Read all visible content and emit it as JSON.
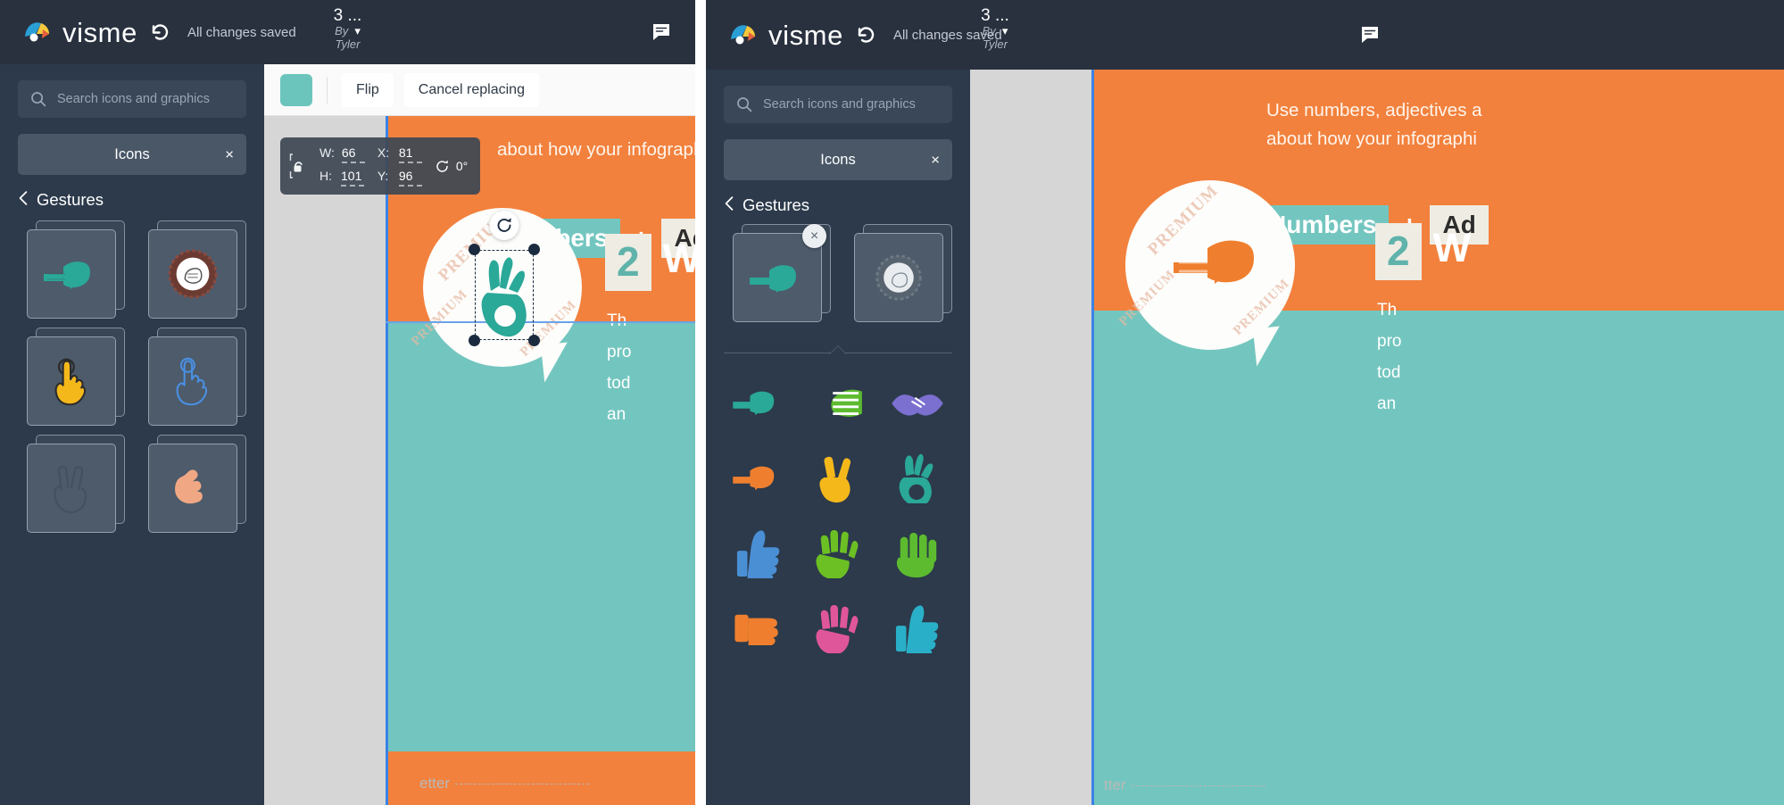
{
  "app": {
    "brand": "visme",
    "save_status": "All changes saved",
    "doc_title": "3 ...",
    "doc_by": "By",
    "doc_author": "Tyler",
    "icons": {
      "undo": "undo-icon",
      "comment": "comment-icon",
      "search": "search-icon",
      "logo": "visme-logo-icon"
    }
  },
  "colors": {
    "topbar": "#29313f",
    "sidebar": "#2c3a4b",
    "accent_teal": "#6cc5bd",
    "accent_orange": "#f2813d",
    "slide_teal": "#73c6bf",
    "guide_blue": "#3b82e6",
    "card": "#4d5b6b"
  },
  "sidebar": {
    "search_placeholder": "Search icons and graphics",
    "category_label": "Icons",
    "close_label": "×",
    "breadcrumb_back": "‹",
    "breadcrumb_label": "Gestures"
  },
  "left_panel": {
    "toolbar": {
      "swatch_color": "#6cc5bd",
      "flip_label": "Flip",
      "cancel_label": "Cancel replacing"
    },
    "transform": {
      "w_label": "W:",
      "w_value": "66",
      "h_label": "H:",
      "h_value": "101",
      "x_label": "X:",
      "x_value": "81",
      "y_label": "Y:",
      "y_value": "96",
      "rotation_value": "0°",
      "lock_icon": "unlock-icon",
      "rotate_icon": "rotate-icon"
    },
    "icon_results": [
      {
        "name": "pointing-hand-right-icon",
        "glyph": "☛",
        "color": "#2aa898",
        "selected": false
      },
      {
        "name": "fist-badge-icon",
        "glyph": "✊",
        "color": "#6b3b32",
        "selected": false
      },
      {
        "name": "tap-hand-yellow-icon",
        "glyph": "☝",
        "color": "#f2b818",
        "selected": false
      },
      {
        "name": "tap-hand-outline-icon",
        "glyph": "☝",
        "color": "#4a90e2",
        "selected": false
      },
      {
        "name": "victory-hand-outline-icon",
        "glyph": "✌",
        "color": "#3d4b5b",
        "selected": false
      },
      {
        "name": "ok-hand-peach-icon",
        "glyph": "👌",
        "color": "#f0a884",
        "selected": false
      }
    ],
    "canvas": {
      "header_text": "about how your infographi",
      "pill_teal": "Numbers",
      "plus": "+",
      "pill_cream": "Ad",
      "watermark": "PREMIUM",
      "step_number": "2",
      "step_word": "W",
      "body_lines": [
        "Th",
        "pro",
        "tod",
        "an"
      ],
      "footer_note": "etter",
      "selected_shape": "ok-hand-teal-icon",
      "selected_glyph": "👌"
    }
  },
  "right_panel": {
    "selected_result": {
      "name": "pointing-hand-right-icon",
      "glyph": "☛",
      "remove_label": "×"
    },
    "second_result": {
      "name": "fist-badge-icon",
      "glyph": "✊"
    },
    "icon_results": [
      {
        "name": "pointing-hand-teal-icon",
        "glyph": "☛",
        "color": "#2aa898"
      },
      {
        "name": "pointing-hand-green-icon",
        "glyph": "☜",
        "color": "#5dbb2f"
      },
      {
        "name": "handshake-purple-icon",
        "glyph": "🤝",
        "color": "#7b6fd0"
      },
      {
        "name": "pointing-hand-orange-icon",
        "glyph": "☛",
        "color": "#ef7f2e"
      },
      {
        "name": "victory-hand-yellow-icon",
        "glyph": "✌",
        "color": "#f5b81b"
      },
      {
        "name": "ok-hand-teal-icon",
        "glyph": "👌",
        "color": "#2aa898"
      },
      {
        "name": "thumbs-up-blue-icon",
        "glyph": "👍",
        "color": "#4a8fd4"
      },
      {
        "name": "raised-hand-green-icon",
        "glyph": "✋",
        "color": "#6cc024"
      },
      {
        "name": "four-fingers-green-icon",
        "glyph": "🤚",
        "color": "#5dbb2f"
      },
      {
        "name": "fist-orange-icon",
        "glyph": "✊",
        "color": "#ef7f2e"
      },
      {
        "name": "raised-hand-pink-icon",
        "glyph": "✋",
        "color": "#e0569b"
      },
      {
        "name": "thumbs-up-cyan-icon",
        "glyph": "👍",
        "color": "#29b0c8"
      }
    ],
    "canvas": {
      "header_line1": "Use numbers, adjectives a",
      "header_line2": "about how your infographi",
      "pill_teal": "Numbers",
      "plus": "+",
      "pill_cream": "Ad",
      "watermark": "PREMIUM",
      "step_number": "2",
      "step_word": "W",
      "body_lines": [
        "Th",
        "pro",
        "tod",
        "an"
      ],
      "footer_note": "tter",
      "placed_shape": "pointing-hand-orange-icon",
      "placed_glyph": "☛"
    }
  }
}
